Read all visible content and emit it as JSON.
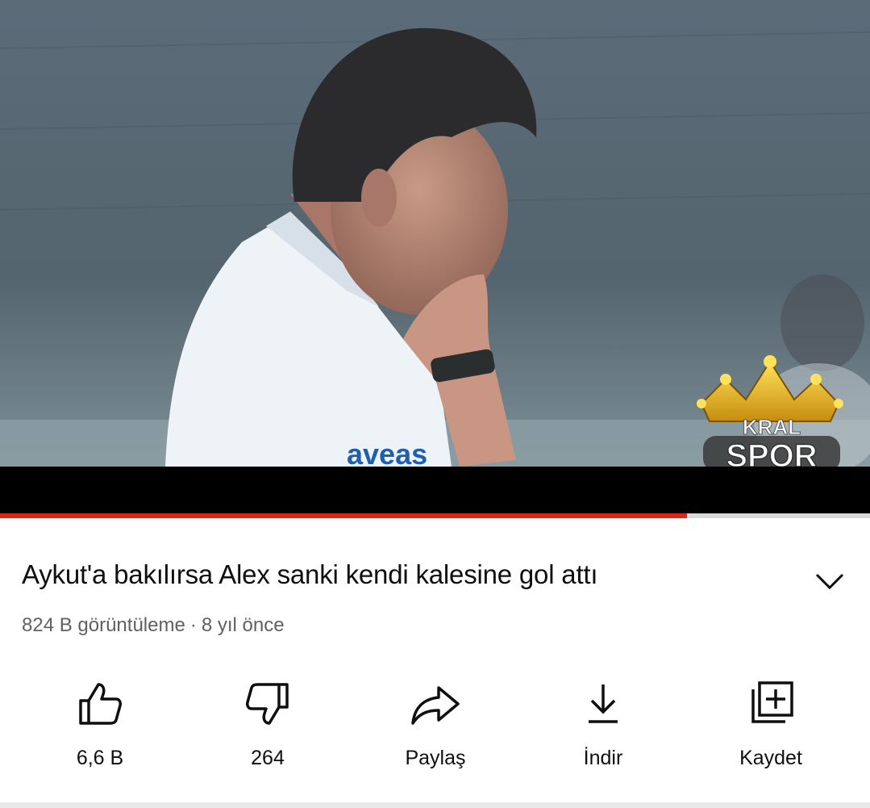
{
  "video": {
    "watermark_top": "KRAL",
    "watermark_bottom": "SPOR",
    "shirt_text": "aveas",
    "progress_fraction": 0.79
  },
  "title": "Aykut'a bakılırsa Alex sanki kendi kalesine gol attı",
  "meta": {
    "views": "824 B görüntüleme",
    "separator": "·",
    "age": "8 yıl önce"
  },
  "actions": [
    {
      "label": "6,6 B",
      "icon": "thumbs-up-icon"
    },
    {
      "label": "264",
      "icon": "thumbs-down-icon"
    },
    {
      "label": "Paylaş",
      "icon": "share-icon"
    },
    {
      "label": "İndir",
      "icon": "download-icon"
    },
    {
      "label": "Kaydet",
      "icon": "save-playlist-icon"
    }
  ],
  "colors": {
    "progress": "#e62117",
    "text": "#0f0f0f",
    "meta_text": "#606060",
    "watermark": "#f2c21a"
  }
}
